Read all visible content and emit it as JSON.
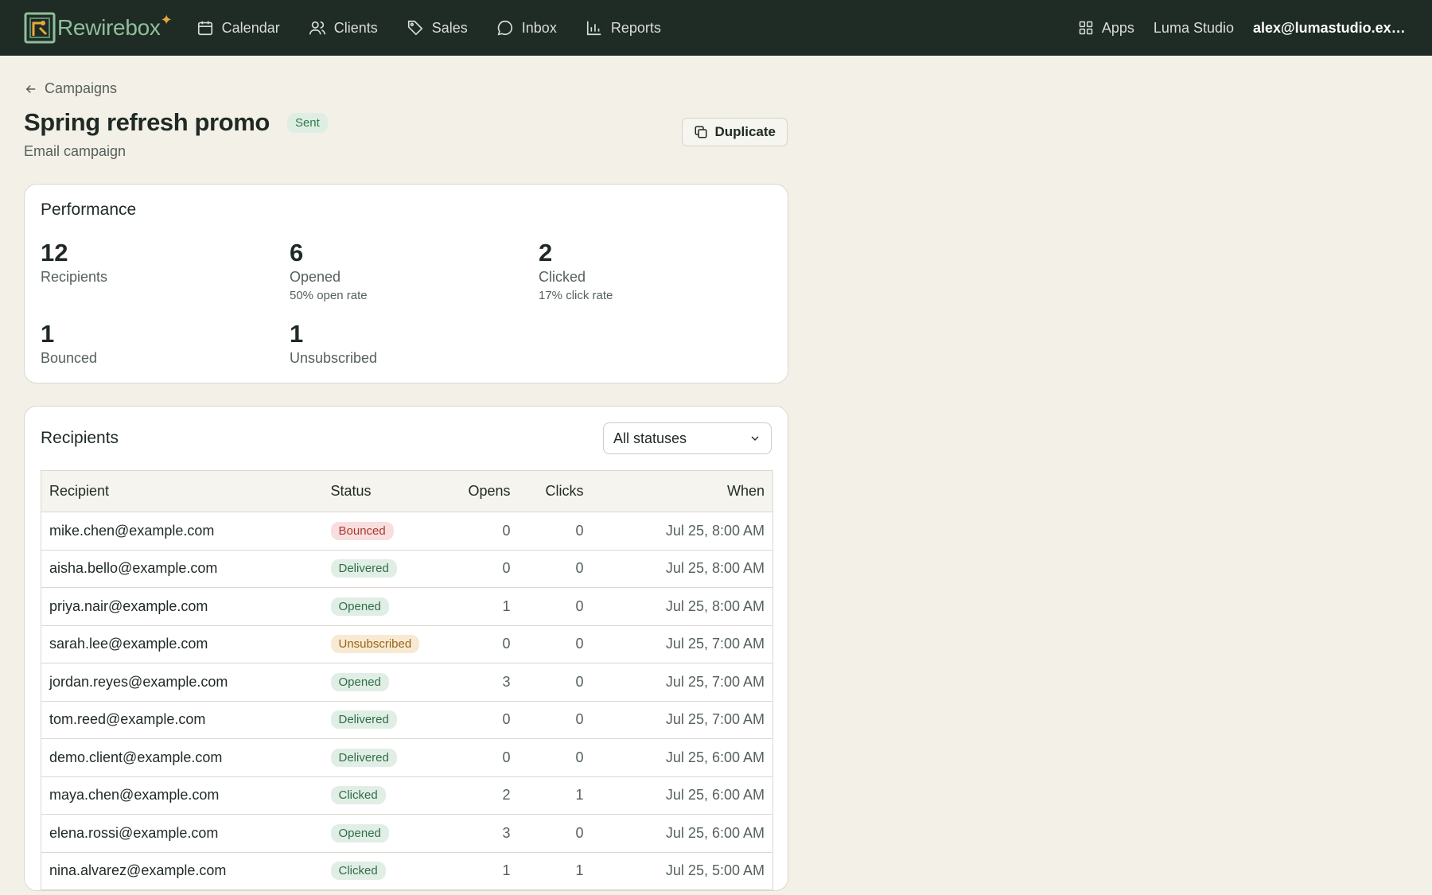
{
  "app": {
    "name": "Rewirebox",
    "nav": [
      {
        "label": "Calendar",
        "icon": "calendar-icon"
      },
      {
        "label": "Clients",
        "icon": "users-icon"
      },
      {
        "label": "Sales",
        "icon": "tag-icon"
      },
      {
        "label": "Inbox",
        "icon": "chat-icon"
      },
      {
        "label": "Reports",
        "icon": "bar-chart-icon"
      }
    ],
    "apps_label": "Apps",
    "workspace": "Luma Studio",
    "user_email": "alex@lumastudio.exam..."
  },
  "page": {
    "back_label": "Campaigns",
    "title": "Spring refresh promo",
    "status_badge": "Sent",
    "subtitle": "Email campaign",
    "duplicate_label": "Duplicate"
  },
  "performance": {
    "title": "Performance",
    "stats": [
      {
        "value": "12",
        "label": "Recipients",
        "sub": ""
      },
      {
        "value": "6",
        "label": "Opened",
        "sub": "50% open rate"
      },
      {
        "value": "2",
        "label": "Clicked",
        "sub": "17% click rate"
      },
      {
        "value": "1",
        "label": "Bounced",
        "sub": ""
      },
      {
        "value": "1",
        "label": "Unsubscribed",
        "sub": ""
      }
    ]
  },
  "recipients": {
    "title": "Recipients",
    "filter_value": "All statuses",
    "columns": [
      "Recipient",
      "Status",
      "Opens",
      "Clicks",
      "When"
    ],
    "rows": [
      {
        "email": "mike.chen@example.com",
        "status": "Bounced",
        "opens": "0",
        "clicks": "0",
        "when": "Jul 25, 8:00 AM"
      },
      {
        "email": "aisha.bello@example.com",
        "status": "Delivered",
        "opens": "0",
        "clicks": "0",
        "when": "Jul 25, 8:00 AM"
      },
      {
        "email": "priya.nair@example.com",
        "status": "Opened",
        "opens": "1",
        "clicks": "0",
        "when": "Jul 25, 8:00 AM"
      },
      {
        "email": "sarah.lee@example.com",
        "status": "Unsubscribed",
        "opens": "0",
        "clicks": "0",
        "when": "Jul 25, 7:00 AM"
      },
      {
        "email": "jordan.reyes@example.com",
        "status": "Opened",
        "opens": "3",
        "clicks": "0",
        "when": "Jul 25, 7:00 AM"
      },
      {
        "email": "tom.reed@example.com",
        "status": "Delivered",
        "opens": "0",
        "clicks": "0",
        "when": "Jul 25, 7:00 AM"
      },
      {
        "email": "demo.client@example.com",
        "status": "Delivered",
        "opens": "0",
        "clicks": "0",
        "when": "Jul 25, 6:00 AM"
      },
      {
        "email": "maya.chen@example.com",
        "status": "Clicked",
        "opens": "2",
        "clicks": "1",
        "when": "Jul 25, 6:00 AM"
      },
      {
        "email": "elena.rossi@example.com",
        "status": "Opened",
        "opens": "3",
        "clicks": "0",
        "when": "Jul 25, 6:00 AM"
      },
      {
        "email": "nina.alvarez@example.com",
        "status": "Clicked",
        "opens": "1",
        "clicks": "1",
        "when": "Jul 25, 5:00 AM"
      }
    ]
  },
  "colors": {
    "topbar": "#1f2b25",
    "background": "#f3f0e8",
    "brand_green": "#8fbf9a",
    "accent_gold": "#e8a93a"
  }
}
